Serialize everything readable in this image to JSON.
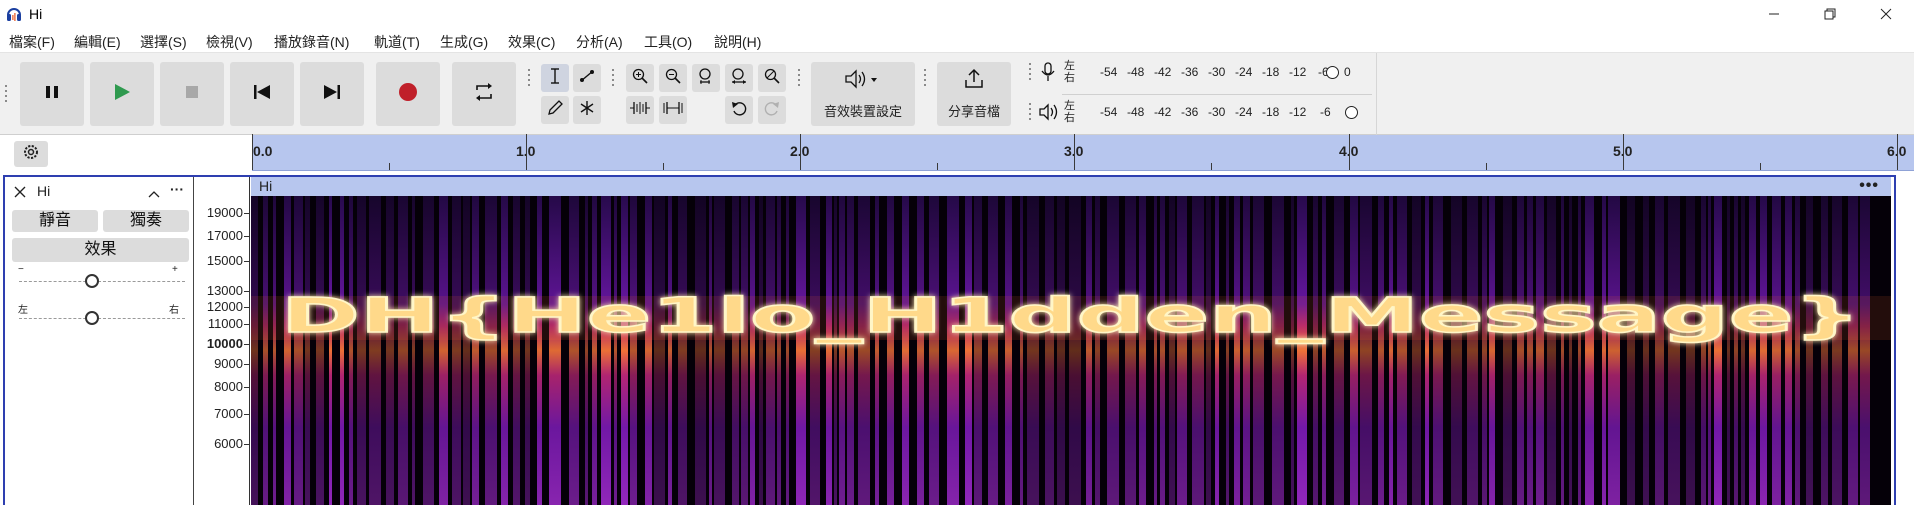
{
  "window": {
    "title": "Hi",
    "controls": [
      "minimize",
      "restore",
      "close"
    ]
  },
  "menu": [
    "檔案(F)",
    "編輯(E)",
    "選擇(S)",
    "檢視(V)",
    "播放錄音(N)",
    "軌道(T)",
    "生成(G)",
    "效果(C)",
    "分析(A)",
    "工具(O)",
    "說明(H)"
  ],
  "toolbar": {
    "transport": [
      "pause-icon",
      "play-icon",
      "stop-icon",
      "skip-to-start-icon",
      "skip-to-end-icon",
      "record-icon",
      "loop-icon"
    ],
    "audio_setup_label": "音效裝置設定",
    "share_audio_label": "分享音檔",
    "meters": {
      "channel_top": "左",
      "channel_bottom": "右",
      "record_scale": [
        "-54",
        "-48",
        "-42",
        "-36",
        "-30",
        "-24",
        "-18",
        "-12",
        "-6",
        "0"
      ],
      "playback_scale": [
        "-54",
        "-48",
        "-42",
        "-36",
        "-30",
        "-24",
        "-18",
        "-12",
        "-6"
      ]
    },
    "colors": {
      "play": "#2f9a4f",
      "record": "#c0202a"
    }
  },
  "ruler": {
    "labels": [
      "0.0",
      "1.0",
      "2.0",
      "3.0",
      "4.0",
      "5.0",
      "6.0"
    ]
  },
  "track": {
    "name": "Hi",
    "mute_label": "靜音",
    "solo_label": "獨奏",
    "effects_label": "效果",
    "gain_min": "−",
    "gain_max": "+",
    "pan_left": "左",
    "pan_right": "右",
    "gain_level": 0.5,
    "pan_level": 0.5
  },
  "clip": {
    "name": "Hi",
    "menu_label": "•••"
  },
  "spectrogram": {
    "freq_labels": [
      "19000",
      "17000",
      "15000",
      "13000",
      "12000",
      "11000",
      "10000",
      "9000",
      "8000",
      "7000",
      "6000"
    ],
    "hidden_text": "DH{He1lo_H1dden_Message}",
    "colors": {
      "background": "#050008",
      "mid": "#6a17a8",
      "hot": "#ff8a3c",
      "peak": "#fff6c8"
    }
  }
}
